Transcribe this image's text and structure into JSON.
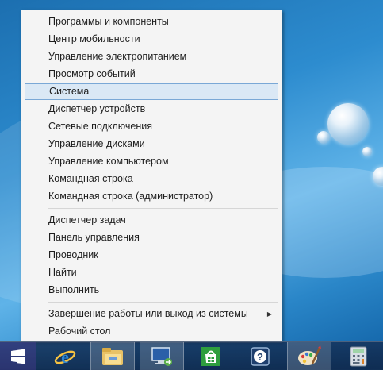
{
  "menu": {
    "items": [
      {
        "label": "Программы и компоненты"
      },
      {
        "label": "Центр мобильности"
      },
      {
        "label": "Управление электропитанием"
      },
      {
        "label": "Просмотр событий"
      },
      {
        "label": "Система",
        "selected": true
      },
      {
        "label": "Диспетчер устройств"
      },
      {
        "label": "Сетевые подключения"
      },
      {
        "label": "Управление дисками"
      },
      {
        "label": "Управление компьютером"
      },
      {
        "label": "Командная строка"
      },
      {
        "label": "Командная строка (администратор)"
      },
      {
        "label": "Диспетчер задач"
      },
      {
        "label": "Панель управления"
      },
      {
        "label": "Проводник"
      },
      {
        "label": "Найти"
      },
      {
        "label": "Выполнить"
      },
      {
        "label": "Завершение работы или выход из системы",
        "has_submenu": true
      },
      {
        "label": "Рабочий стол"
      }
    ]
  },
  "taskbar": {
    "buttons": [
      {
        "icon": "windows-start-icon"
      },
      {
        "icon": "internet-explorer-icon"
      },
      {
        "icon": "file-explorer-icon"
      },
      {
        "icon": "remote-desktop-icon"
      },
      {
        "icon": "store-icon"
      },
      {
        "icon": "help-icon"
      },
      {
        "icon": "paint-icon"
      },
      {
        "icon": "calculator-icon"
      }
    ]
  },
  "colors": {
    "menu_bg": "#f4f4f4",
    "selected_bg": "#dae8f5",
    "selected_border": "#7aa8d6",
    "taskbar_bg": "#163a66"
  }
}
